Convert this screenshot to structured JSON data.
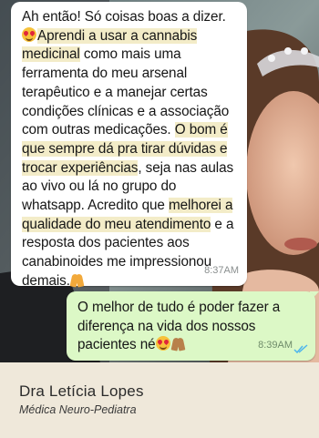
{
  "colors": {
    "incoming_bubble": "#ffffff",
    "outgoing_bubble": "#dcf8c6",
    "highlight": "#f3ecc8",
    "footer_bg": "#efe8da",
    "read_ticks": "#4fb6ec"
  },
  "messages": {
    "incoming": {
      "lines": [
        [
          {
            "t": "Ah então! Só coisas boas a dizer."
          }
        ],
        [
          {
            "emoji": "heart-eyes-emoji"
          },
          {
            "t": "Aprendi a usar a cannabis",
            "hl": true
          }
        ],
        [
          {
            "t": "medicinal",
            "hl": true
          },
          {
            "t": " como mais uma"
          }
        ],
        [
          {
            "t": "ferramenta do meu arsenal"
          }
        ],
        [
          {
            "t": "terapêutico e a manejar certas"
          }
        ],
        [
          {
            "t": "condições clínicas e a associação"
          }
        ],
        [
          {
            "t": "com outras medicações. "
          },
          {
            "t": "O bom é",
            "hl": true
          }
        ],
        [
          {
            "t": "que sempre dá pra tirar dúvidas e",
            "hl": true
          }
        ],
        [
          {
            "t": "trocar experiências",
            "hl": true
          },
          {
            "t": ", seja nas aulas"
          }
        ],
        [
          {
            "t": "ao vivo ou lá no grupo do"
          }
        ],
        [
          {
            "t": "whatsapp. Acredito que "
          },
          {
            "t": "melhorei a",
            "hl": true
          }
        ],
        [
          {
            "t": "qualidade do meu atendimento",
            "hl": true
          },
          {
            "t": " e a"
          }
        ],
        [
          {
            "t": "resposta dos pacientes aos"
          }
        ],
        [
          {
            "t": "canabinoides me impressionou"
          }
        ],
        [
          {
            "t": "demais."
          },
          {
            "emoji": "praying-hands-emoji"
          }
        ]
      ],
      "time": "8:37AM"
    },
    "outgoing": {
      "lines": [
        [
          {
            "t": "O melhor de tudo é poder fazer a"
          }
        ],
        [
          {
            "t": "diferença na vida dos nossos"
          }
        ],
        [
          {
            "t": "pacientes né"
          },
          {
            "emoji": "heart-eyes-emoji"
          },
          {
            "emoji": "praying-hands-dark-emoji"
          }
        ]
      ],
      "time": "8:39AM",
      "status_icon": "double-check-read-icon"
    }
  },
  "footer": {
    "name": "Dra Letícia Lopes",
    "role": "Médica Neuro-Pediatra"
  }
}
